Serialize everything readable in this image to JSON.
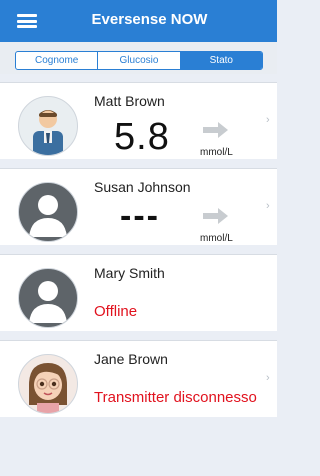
{
  "app": {
    "title": "Eversense NOW"
  },
  "tabs": [
    {
      "label": "Cognome",
      "active": false
    },
    {
      "label": "Glucosio",
      "active": false
    },
    {
      "label": "Stato",
      "active": true
    }
  ],
  "rows": [
    {
      "name": "Matt Brown",
      "glucose": "5.8",
      "unit": "mmol/L",
      "trend": "arrow-right-icon",
      "avatar": "man-avatar-icon"
    },
    {
      "name": "Susan Johnson",
      "glucose": "---",
      "unit": "mmol/L",
      "trend": "arrow-right-icon",
      "avatar": "default-avatar-icon"
    },
    {
      "name": "Mary Smith",
      "status": "Offline",
      "avatar": "default-avatar-icon"
    },
    {
      "name": "Jane Brown",
      "status": "Transmitter disconnesso",
      "avatar": "girl-avatar-icon"
    }
  ],
  "colors": {
    "accent": "#2a7fd4",
    "error": "#e1121e",
    "background": "#eaeef5"
  }
}
